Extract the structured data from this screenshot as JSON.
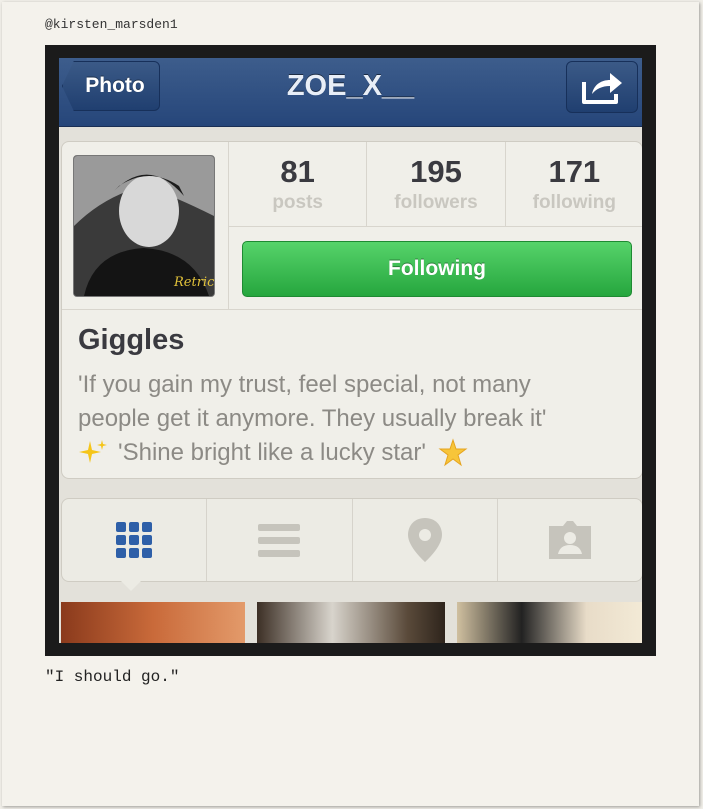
{
  "watermark": {
    "handle": "@kirsten_marsden1",
    "caption": "\"I should go.\""
  },
  "navbar": {
    "back_label": "Photo",
    "title": "ZOE_X__",
    "share_icon": "share-icon"
  },
  "profile": {
    "stats": [
      {
        "value": "81",
        "label": "posts"
      },
      {
        "value": "195",
        "label": "followers"
      },
      {
        "value": "171",
        "label": "following"
      }
    ],
    "follow_button": "Following",
    "follow_color": "#2fb548",
    "name": "Giggles",
    "bio_line1": "'If you gain my trust, feel special, not many",
    "bio_line2": "people get it anymore. They usually break it'",
    "bio_line3": "'Shine bright like a lucky star'",
    "avatar_watermark": "Retrica"
  },
  "tabs": [
    {
      "icon": "grid-icon",
      "active": true
    },
    {
      "icon": "list-icon",
      "active": false
    },
    {
      "icon": "location-pin-icon",
      "active": false
    },
    {
      "icon": "tagged-photos-icon",
      "active": false
    }
  ],
  "colors": {
    "nav": "#2f4f80",
    "active_tab": "#2e5fa8",
    "inactive_tab": "#c6c4bc"
  }
}
